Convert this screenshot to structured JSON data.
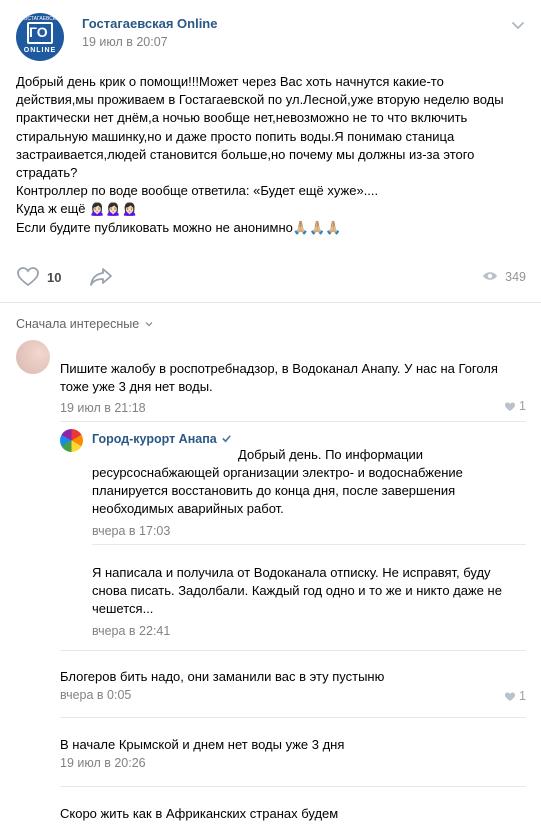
{
  "post": {
    "group_name": "Гостагаевская Online",
    "avatar_small_text": "ГОСТАГАЕВСКАЯ",
    "avatar_logo": "ГО",
    "avatar_online": "ONLINE",
    "date": "19 июл в 20:07",
    "lines": [
      "Добрый день крик о помощи!!!Может через Вас хоть начнутся какие-то",
      "действия,мы проживаем в Гостагаевской по ул.Лесной,уже вторую неделю воды",
      "практически нет днём,а ночью вообще нет,невозможно не то что включить",
      "стиральную машинку,но и даже просто попить воды.Я понимаю станица",
      "застраивается,людей становится больше,но почему мы должны из-за этого",
      "страдать?",
      "Контроллер по воде вообще ответила: «Будет ещё хуже»....",
      "Куда ж ещё 🙍🏻‍♀️🙍🏻‍♀️🙍🏻‍♀️",
      "Если будите публиковать можно не анонимно🙏🏼🙏🏼🙏🏼"
    ],
    "likes": "10",
    "views": "349"
  },
  "sort_label": "Сначала интересные",
  "comments": [
    {
      "author": "",
      "lines": [
        "Пишите жалобу в роспотребнадзор, в Водоканал Анапу. У нас на Гоголя",
        "тоже уже 3 дня нет воды."
      ],
      "date": "19 июл в 21:18",
      "likes": "1"
    },
    {
      "author": "Город-курорт Анапа",
      "first_line": "Добрый день. По информации",
      "lines": [
        "ресурсоснабжающей организации электро- и водоснабжение",
        "планируется восстановить до конца дня, после завершения",
        "необходимых аварийных работ."
      ],
      "date": "вчера в 17:03"
    },
    {
      "author": "",
      "lines": [
        "Я написала и получила от Водоканала отписку. Не исправят, буду",
        "снова писать. Задолбали. Каждый год одно и то же и никто даже не",
        "чешется..."
      ],
      "date": "вчера в 22:41"
    },
    {
      "author": "",
      "lines": [
        "Блогеров бить надо, они заманили вас в эту пустыню"
      ],
      "date": "вчера в 0:05",
      "likes": "1"
    },
    {
      "author": "",
      "lines": [
        "В начале Крымской и днем нет воды уже 3 дня"
      ],
      "date": "19 июл в 20:26"
    },
    {
      "author": "",
      "lines": [
        "Скоро жить как в Африканских странах будем"
      ],
      "date": ""
    }
  ],
  "colors": {
    "link": "#2a5885",
    "meta": "#828282",
    "divider": "#e7e8ec",
    "brand": "#1e5aa0"
  }
}
